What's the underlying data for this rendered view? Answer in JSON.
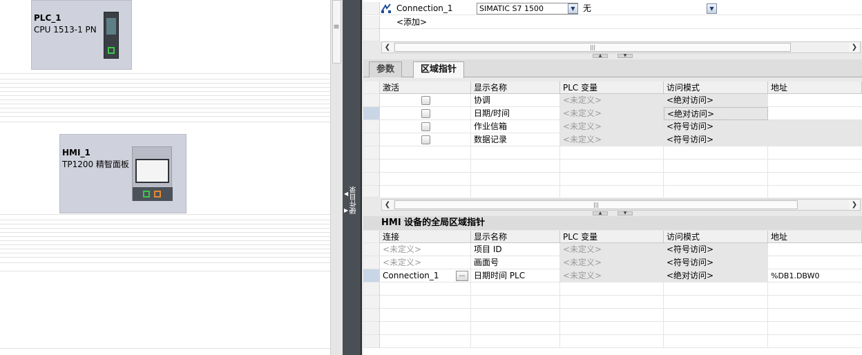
{
  "devices": {
    "plc": {
      "name": "PLC_1",
      "type": "CPU 1513-1 PN"
    },
    "hmi": {
      "name": "HMI_1",
      "type": "TP1200 精智面板"
    }
  },
  "sidebar": {
    "label": "硬件目录"
  },
  "connection_table": {
    "rows": [
      {
        "name": "Connection_1",
        "device": "SIMATIC S7 1500",
        "option": "无"
      },
      {
        "name": "<添加>"
      }
    ]
  },
  "tabs": [
    {
      "label": "参数",
      "active": false
    },
    {
      "label": "区域指针",
      "active": true
    }
  ],
  "area_pointers": {
    "headers": [
      "激活",
      "显示名称",
      "PLC 变量",
      "访问模式",
      "地址"
    ],
    "rows": [
      {
        "display_name": "协调",
        "plc_tag": "<未定义>",
        "access_mode": "<绝对访问>",
        "address": "",
        "checked": false
      },
      {
        "display_name": "日期/时间",
        "plc_tag": "<未定义>",
        "access_mode": "<绝对访问>",
        "address": "",
        "checked": false
      },
      {
        "display_name": "作业信箱",
        "plc_tag": "<未定义>",
        "access_mode": "<符号访问>",
        "address": "",
        "checked": false
      },
      {
        "display_name": "数据记录",
        "plc_tag": "<未定义>",
        "access_mode": "<符号访问>",
        "address": "",
        "checked": false
      }
    ]
  },
  "global_pointers": {
    "title": "HMI 设备的全局区域指针",
    "headers": [
      "连接",
      "显示名称",
      "PLC 变量",
      "访问模式",
      "地址"
    ],
    "rows": [
      {
        "connection": "<未定义>",
        "display_name": "项目 ID",
        "plc_tag": "<未定义>",
        "access_mode": "<符号访问>",
        "address": ""
      },
      {
        "connection": "<未定义>",
        "display_name": "画面号",
        "plc_tag": "<未定义>",
        "access_mode": "<符号访问>",
        "address": ""
      },
      {
        "connection": "Connection_1",
        "display_name": "日期时间 PLC",
        "plc_tag": "<未定义>",
        "access_mode": "<绝对访问>",
        "address": "%DB1.DBW0"
      }
    ]
  },
  "colors": {
    "accent": "#2b2b2b",
    "device_fill": "#cfd1dc",
    "port_green": "#3cc84a",
    "port_orange": "#e8892e"
  }
}
